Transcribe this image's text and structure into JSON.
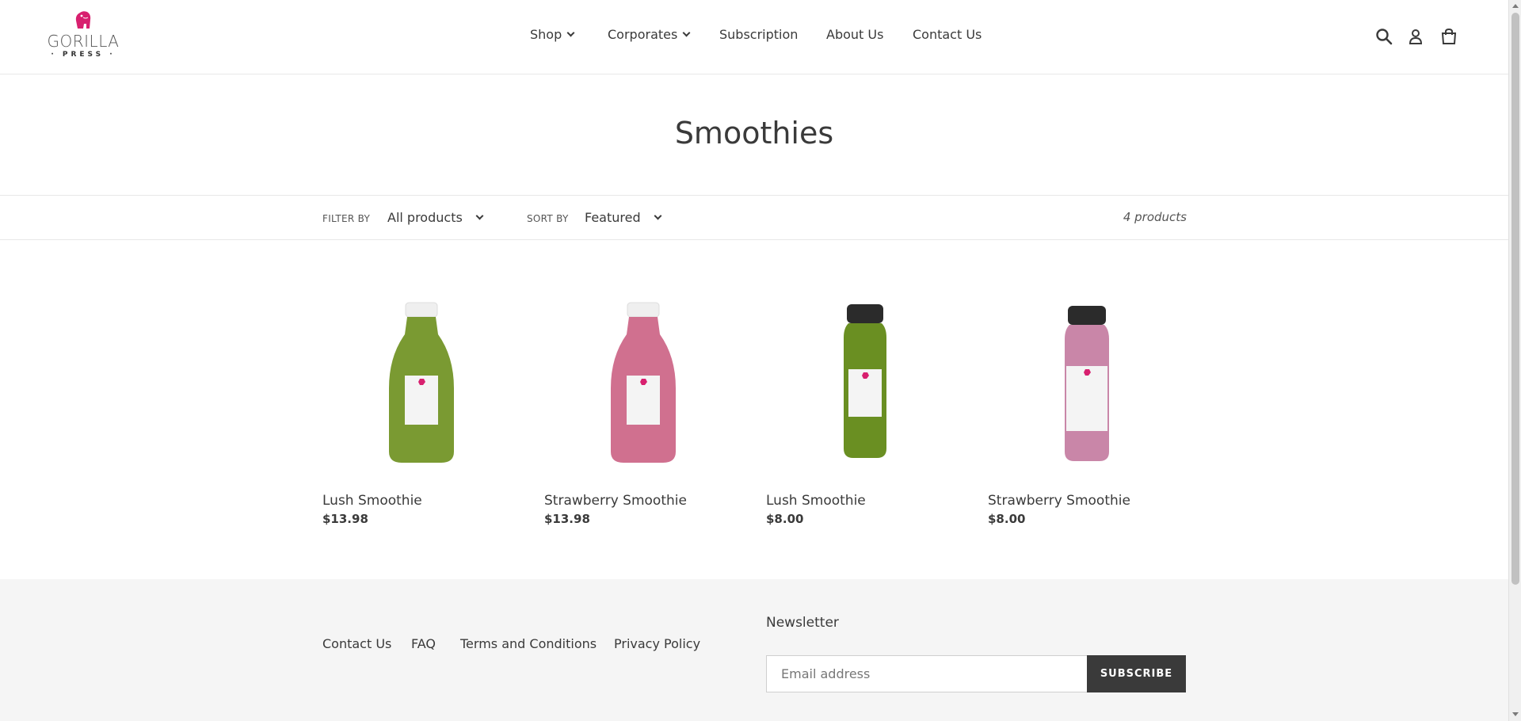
{
  "brand": {
    "name": "GORILLA",
    "sub": "PRESS",
    "accent": "#d8206f"
  },
  "nav": {
    "items": [
      {
        "label": "Shop",
        "dropdown": true
      },
      {
        "label": "Corporates",
        "dropdown": true
      },
      {
        "label": "Subscription",
        "dropdown": false
      },
      {
        "label": "About Us",
        "dropdown": false
      },
      {
        "label": "Contact Us",
        "dropdown": false
      }
    ]
  },
  "header_icons": [
    "search-icon",
    "account-icon",
    "cart-icon"
  ],
  "page": {
    "title": "Smoothies"
  },
  "filters": {
    "filter_label": "FILTER BY",
    "filter_value": "All products",
    "sort_label": "SORT BY",
    "sort_value": "Featured",
    "count": "4 products"
  },
  "products": [
    {
      "name": "Lush Smoothie",
      "price": "$13.98",
      "bottle": "tall",
      "cap": "#f2f2f2",
      "liquid": "#7a9a32"
    },
    {
      "name": "Strawberry Smoothie",
      "price": "$13.98",
      "bottle": "tall",
      "cap": "#f2f2f2",
      "liquid": "#d0708f"
    },
    {
      "name": "Lush Smoothie",
      "price": "$8.00",
      "bottle": "short",
      "cap": "#2b2b2b",
      "liquid": "#6a8f22"
    },
    {
      "name": "Strawberry Smoothie",
      "price": "$8.00",
      "bottle": "short",
      "cap": "#2b2b2b",
      "liquid": "#c986a8"
    }
  ],
  "footer": {
    "links": [
      "Contact Us",
      "FAQ",
      "Terms and Conditions",
      "Privacy Policy"
    ],
    "newsletter_title": "Newsletter",
    "email_placeholder": "Email address",
    "subscribe_label": "SUBSCRIBE"
  }
}
